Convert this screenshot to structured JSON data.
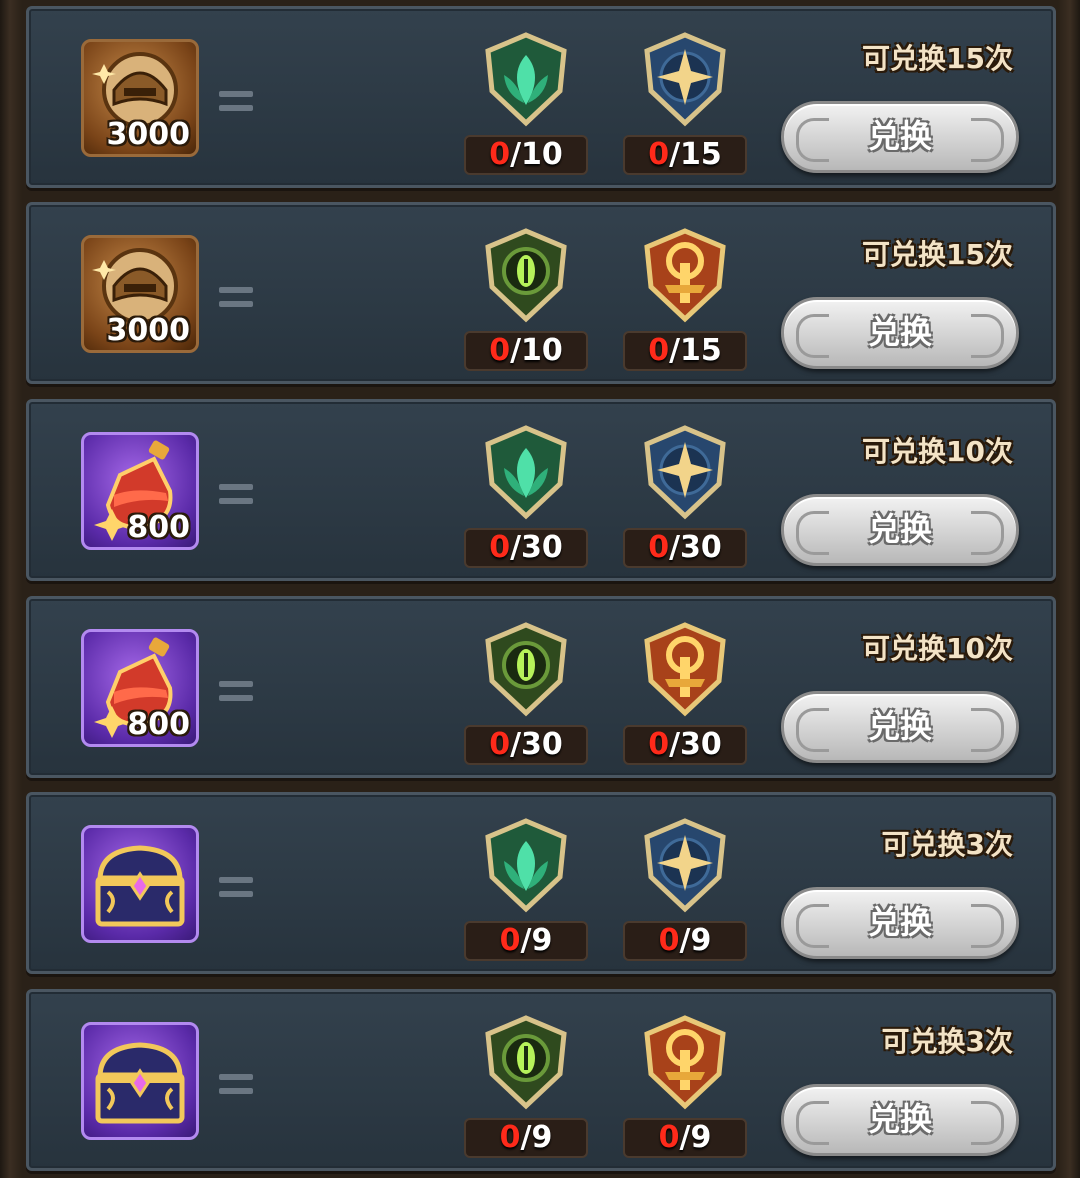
{
  "exchange_list": {
    "rows": [
      {
        "reward": {
          "icon": "helmet-medallion-icon",
          "frame": "bronze",
          "quantity": "3000"
        },
        "costs": [
          {
            "icon": "green-leaf-emblem-icon",
            "have": "0",
            "need": "/10"
          },
          {
            "icon": "blue-star-emblem-icon",
            "have": "0",
            "need": "/15"
          }
        ],
        "limit": "可兑换15次",
        "button": "兑换"
      },
      {
        "reward": {
          "icon": "helmet-medallion-icon",
          "frame": "bronze",
          "quantity": "3000"
        },
        "costs": [
          {
            "icon": "green-eye-emblem-icon",
            "have": "0",
            "need": "/10"
          },
          {
            "icon": "gold-sword-emblem-icon",
            "have": "0",
            "need": "/15"
          }
        ],
        "limit": "可兑换15次",
        "button": "兑换"
      },
      {
        "reward": {
          "icon": "red-potion-icon",
          "frame": "purple",
          "quantity": "800"
        },
        "costs": [
          {
            "icon": "green-leaf-emblem-icon",
            "have": "0",
            "need": "/30"
          },
          {
            "icon": "blue-star-emblem-icon",
            "have": "0",
            "need": "/30"
          }
        ],
        "limit": "可兑换10次",
        "button": "兑换"
      },
      {
        "reward": {
          "icon": "red-potion-icon",
          "frame": "purple",
          "quantity": "800"
        },
        "costs": [
          {
            "icon": "green-eye-emblem-icon",
            "have": "0",
            "need": "/30"
          },
          {
            "icon": "gold-sword-emblem-icon",
            "have": "0",
            "need": "/30"
          }
        ],
        "limit": "可兑换10次",
        "button": "兑换"
      },
      {
        "reward": {
          "icon": "treasure-chest-icon",
          "frame": "purple",
          "quantity": ""
        },
        "costs": [
          {
            "icon": "green-leaf-emblem-icon",
            "have": "0",
            "need": "/9"
          },
          {
            "icon": "blue-star-emblem-icon",
            "have": "0",
            "need": "/9"
          }
        ],
        "limit": "可兑换3次",
        "button": "兑换"
      },
      {
        "reward": {
          "icon": "treasure-chest-icon",
          "frame": "purple",
          "quantity": ""
        },
        "costs": [
          {
            "icon": "green-eye-emblem-icon",
            "have": "0",
            "need": "/9"
          },
          {
            "icon": "gold-sword-emblem-icon",
            "have": "0",
            "need": "/9"
          }
        ],
        "limit": "可兑换3次",
        "button": "兑换"
      }
    ]
  },
  "colors": {
    "panel": "#2c3944",
    "have_count": "#ff2a1a",
    "limit_text": "#f3e3c6",
    "button_face": "#d8d8d8"
  }
}
